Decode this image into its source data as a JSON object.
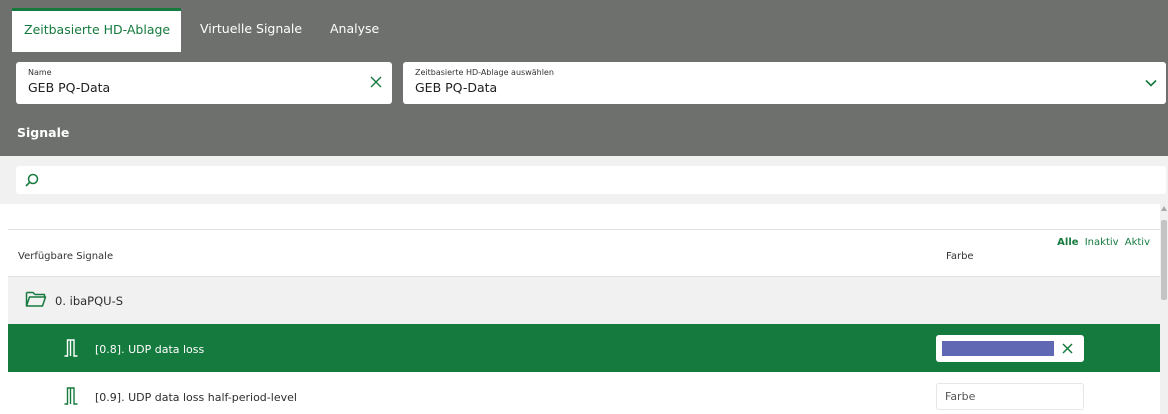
{
  "tabs": [
    {
      "label": "Zeitbasierte HD-Ablage",
      "active": true
    },
    {
      "label": "Virtuelle Signale",
      "active": false
    },
    {
      "label": "Analyse",
      "active": false
    }
  ],
  "fields": {
    "name": {
      "label": "Name",
      "value": "GEB PQ-Data",
      "icon": "close-icon"
    },
    "store": {
      "label": "Zeitbasierte HD-Ablage auswählen",
      "value": "GEB PQ-Data",
      "icon": "chevron-down-icon"
    }
  },
  "signals_section": {
    "title": "Signale"
  },
  "search": {
    "placeholder": "",
    "value": "",
    "icon": "search-icon"
  },
  "filters": {
    "all": "Alle",
    "inactive": "Inaktiv",
    "active": "Aktiv"
  },
  "table": {
    "columns": {
      "available": "Verfügbare Signale",
      "color": "Farbe"
    },
    "group": {
      "label": "0. ibaPQU-S",
      "icon": "folder-icon"
    },
    "rows": [
      {
        "label": "[0.8]. UDP data loss",
        "selected": true,
        "color": "#6168b3",
        "icon": "digital-signal-icon"
      },
      {
        "label": "[0.9]. UDP data loss half-period-level",
        "selected": false,
        "color_placeholder": "Farbe",
        "icon": "digital-signal-icon"
      }
    ]
  },
  "colors": {
    "accent": "#157a3e",
    "header": "#6d706c",
    "panel": "#f1f1f1"
  }
}
